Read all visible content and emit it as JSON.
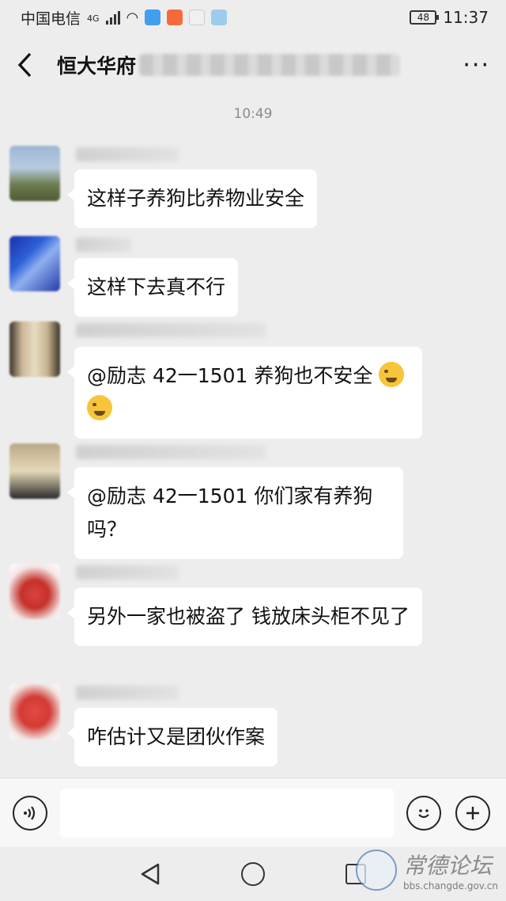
{
  "status_bar": {
    "carrier": "中国电信",
    "network": "4G",
    "battery": "48",
    "time": "11:37"
  },
  "header": {
    "back_icon": "chevron-left-icon",
    "title": "恒大华府",
    "more_icon": "ellipsis-icon",
    "more": "···"
  },
  "chat": {
    "timestamp": "10:49",
    "messages": [
      {
        "text": "这样子养狗比养物业安全"
      },
      {
        "text": "这样下去真不行"
      },
      {
        "text": "@励志 42一1501  养狗也不安全"
      },
      {
        "text": "@励志 42一1501  你们家有养狗吗？"
      },
      {
        "text": "另外一家也被盗了 钱放床头柜不见了"
      },
      {
        "text": "咋估计又是团伙作案"
      }
    ]
  },
  "input_bar": {
    "voice_icon": "voice-icon",
    "emoji_icon": "emoji-icon",
    "plus_icon": "plus-icon",
    "placeholder": ""
  },
  "nav_bar": {
    "back": "◁",
    "home": "home-icon",
    "recent": "recent-apps-icon"
  },
  "watermark": {
    "title": "常德论坛",
    "url": "bbs.changde.gov.cn"
  },
  "colors": {
    "background": "#ededed",
    "bubble": "#ffffff",
    "input_bar": "#f7f7f7"
  }
}
